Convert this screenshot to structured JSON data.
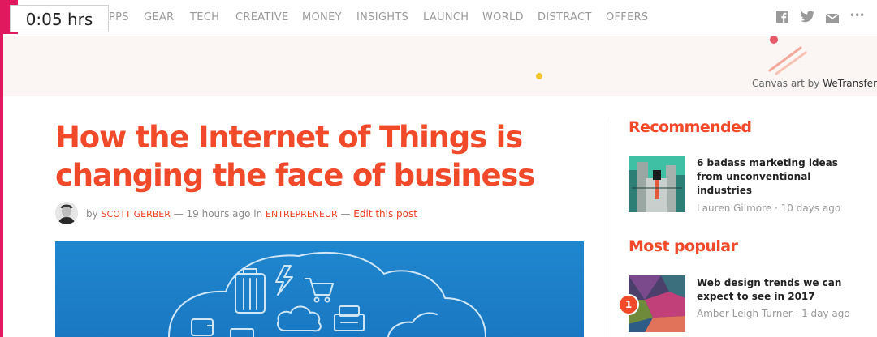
{
  "timer": {
    "text": "0:05 hrs"
  },
  "nav": {
    "items": [
      "APPS",
      "GEAR",
      "TECH",
      "CREATIVE",
      "MONEY",
      "INSIGHTS",
      "LAUNCH",
      "WORLD",
      "DISTRACT",
      "OFFERS"
    ],
    "visible_first": "PPS"
  },
  "social": {
    "icons": [
      "facebook-icon",
      "twitter-icon",
      "email-icon",
      "more-icon"
    ],
    "more_glyph": "•••"
  },
  "banner": {
    "credit_prefix": "Canvas art by ",
    "credit_brand": "WeTransfer"
  },
  "article": {
    "title": "How the Internet of Things is changing the face of business",
    "by": "by",
    "author": "SCOTT GERBER",
    "sep1": " — ",
    "time": "19 hours ago",
    "in": " in ",
    "category": "ENTREPRENEUR",
    "sep2": " — ",
    "edit": "Edit this post"
  },
  "sidebar": {
    "recommended": {
      "heading": "Recommended",
      "item": {
        "title": "6 badass marketing ideas from unconventional industries",
        "author": "Lauren Gilmore",
        "sep": " · ",
        "time": "10 days ago"
      }
    },
    "popular": {
      "heading": "Most popular",
      "item": {
        "rank": "1",
        "title": "Web design trends we can expect to see in 2017",
        "author": "Amber Leigh Turner",
        "sep": " · ",
        "time": "1 day ago"
      }
    }
  },
  "colors": {
    "accent": "#f04a2a",
    "brand_pink": "#e0195f",
    "hero_blue": "#1f87cf",
    "nav_text": "#9a9a9a"
  }
}
